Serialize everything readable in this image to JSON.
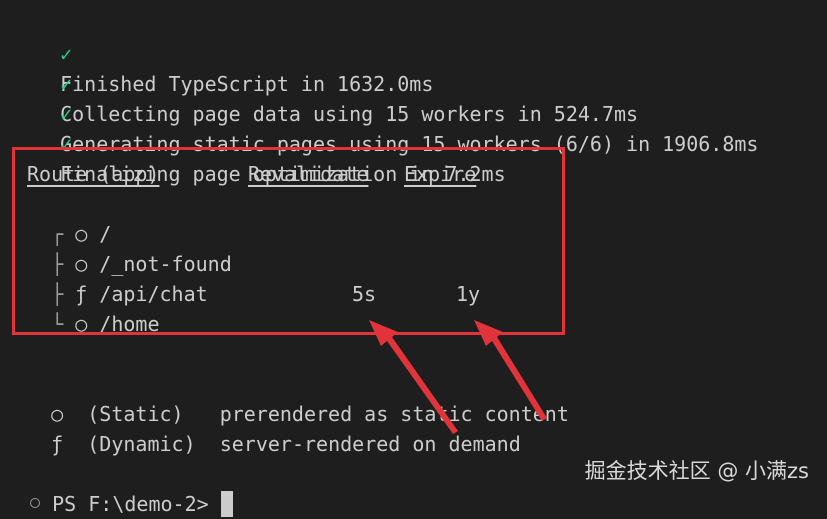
{
  "build_log": [
    {
      "check": "✓",
      "text": "Finished TypeScript in 1632.0ms"
    },
    {
      "check": "✓",
      "text": "Collecting page data using 15 workers in 524.7ms"
    },
    {
      "check": "✓",
      "text": "Generating static pages using 15 workers (6/6) in 1906.8ms"
    },
    {
      "check": "✓",
      "text": "Finalizing page optimization in 7.2ms"
    }
  ],
  "routes_table": {
    "headers": {
      "route": "Route (app)",
      "revalidate": "Revalidate",
      "expire": "Expire"
    },
    "rows": [
      {
        "tree": "┌",
        "symbol": "○",
        "path": "/",
        "revalidate": "",
        "expire": ""
      },
      {
        "tree": "├",
        "symbol": "○",
        "path": "/_not-found",
        "revalidate": "",
        "expire": ""
      },
      {
        "tree": "├",
        "symbol": "ƒ",
        "path": "/api/chat",
        "revalidate": "",
        "expire": ""
      },
      {
        "tree": "└",
        "symbol": "○",
        "path": "/home",
        "revalidate": "5s",
        "expire": "1y"
      }
    ]
  },
  "legend": [
    {
      "symbol": "○",
      "label": "(Static)",
      "description": "prerendered as static content"
    },
    {
      "symbol": "ƒ",
      "label": "(Dynamic)",
      "description": "server-rendered on demand"
    }
  ],
  "prompt": {
    "text": "PS F:\\demo-2>"
  },
  "watermark": {
    "text": "掘金技术社区 @ 小满zs"
  },
  "colors": {
    "background": "#1e1e1e",
    "text": "#cccccc",
    "check": "#23d18b",
    "annotation": "#e0343a"
  }
}
